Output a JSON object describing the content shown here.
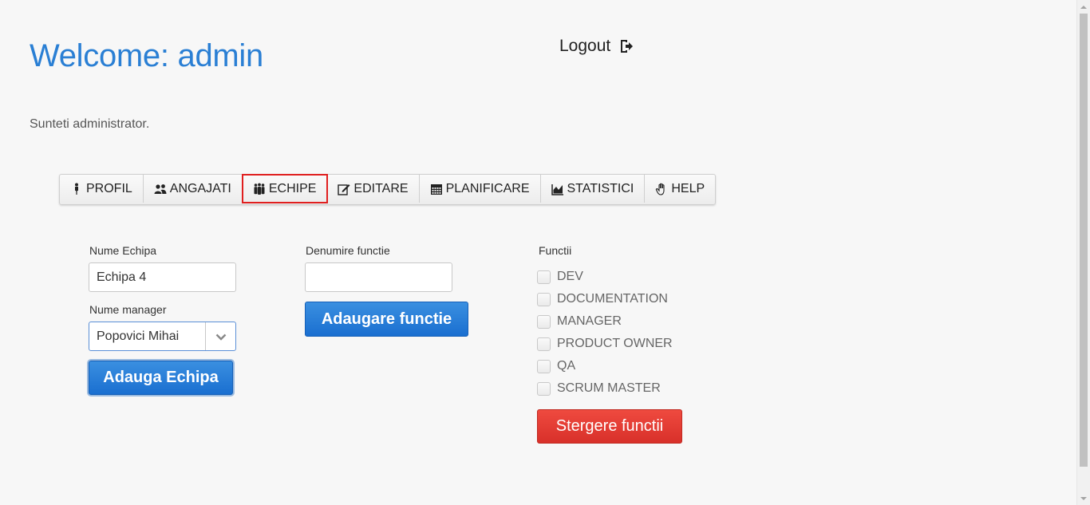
{
  "header": {
    "welcome": "Welcome: admin",
    "logout_label": "Logout",
    "subtitle": "Sunteti administrator."
  },
  "tabs": [
    {
      "label": "PROFIL",
      "icon": "person-icon"
    },
    {
      "label": "ANGAJATI",
      "icon": "users-icon"
    },
    {
      "label": "ECHIPE",
      "icon": "team-icon",
      "active": true
    },
    {
      "label": "EDITARE",
      "icon": "edit-icon"
    },
    {
      "label": "PLANIFICARE",
      "icon": "calendar-icon"
    },
    {
      "label": "STATISTICI",
      "icon": "area-chart-icon"
    },
    {
      "label": "HELP",
      "icon": "hand-icon"
    }
  ],
  "team_form": {
    "name_label": "Nume Echipa",
    "name_value": "Echipa 4",
    "manager_label": "Nume manager",
    "manager_value": "Popovici Mihai",
    "submit_label": "Adauga Echipa"
  },
  "function_form": {
    "name_label": "Denumire functie",
    "name_value": "",
    "submit_label": "Adaugare functie"
  },
  "functions": {
    "label": "Functii",
    "items": [
      "DEV",
      "DOCUMENTATION",
      "MANAGER",
      "PRODUCT OWNER",
      "QA",
      "SCRUM MASTER"
    ],
    "delete_label": "Stergere functii"
  },
  "colors": {
    "accent": "#2a7fd4",
    "primary_button": "#1a6fd0",
    "danger_button": "#d8302a",
    "active_tab_outline": "#e01f1f"
  }
}
